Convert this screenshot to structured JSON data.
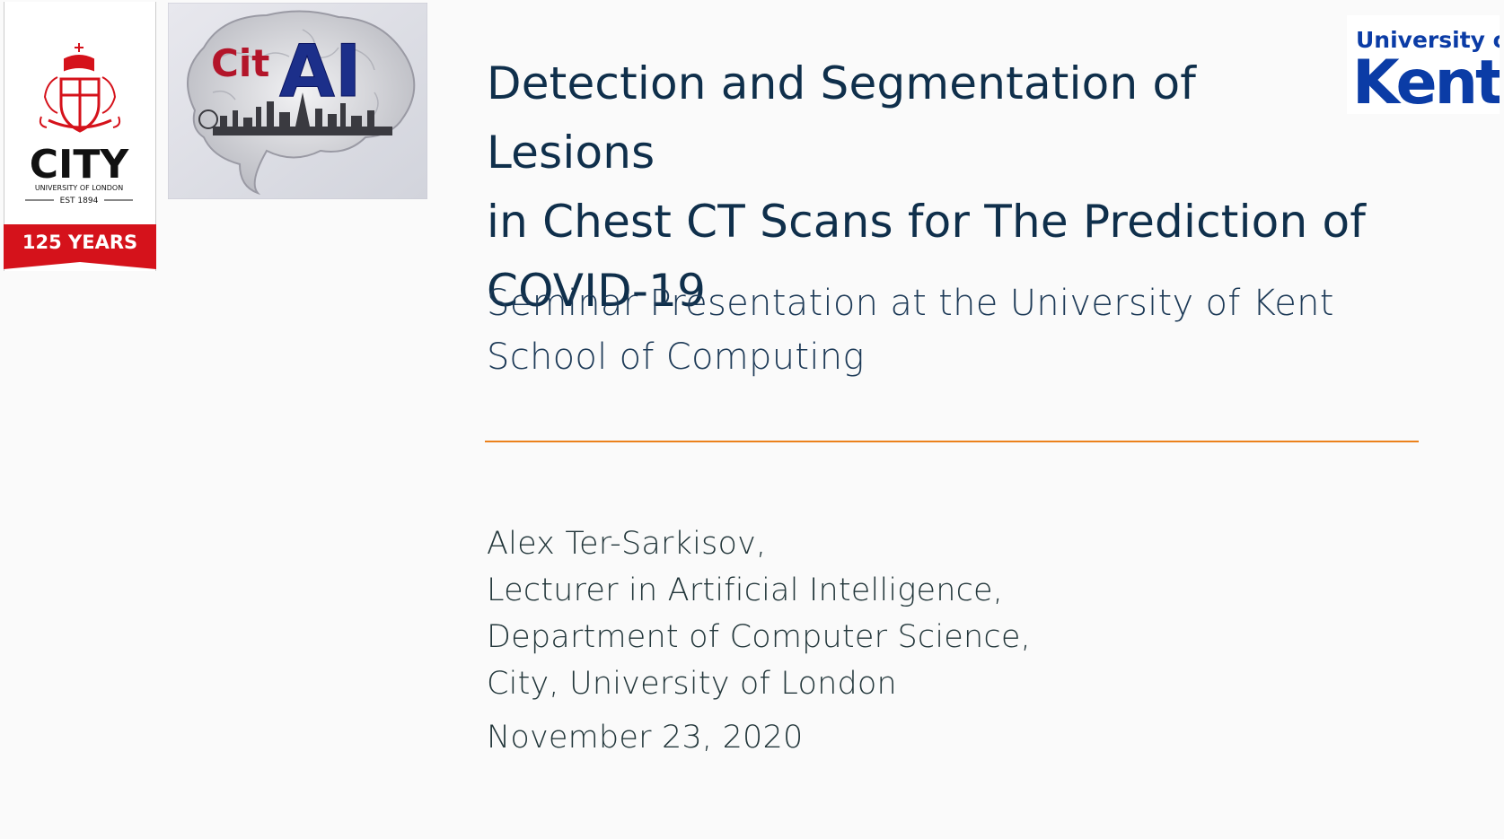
{
  "logos": {
    "city": {
      "wordmark": "CITY",
      "subtext": "UNIVERSITY OF LONDON",
      "est": "EST 1894",
      "banner": "125 YEARS",
      "red": "#d5121b"
    },
    "citai": {
      "text_cit": "Cit",
      "text_ai": "AI",
      "red": "#b3152a",
      "blue": "#1c2f8a"
    },
    "kent": {
      "line1": "University of",
      "line2": "Kent",
      "blue": "#0b3ca6"
    }
  },
  "slide": {
    "title_line1": "Detection and Segmentation of Lesions",
    "title_line2": "in Chest CT Scans for The Prediction of",
    "title_line3": "COVID-19",
    "subtitle_line1": "Seminar Presentation at the University of Kent",
    "subtitle_line2": "School of Computing",
    "author_line1": "Alex Ter-Sarkisov,",
    "author_line2": "Lecturer in Artificial Intelligence,",
    "author_line3": "Department of Computer Science,",
    "author_line4": "City, University of London",
    "date": "November 23, 2020",
    "accent_color": "#eb811b"
  }
}
